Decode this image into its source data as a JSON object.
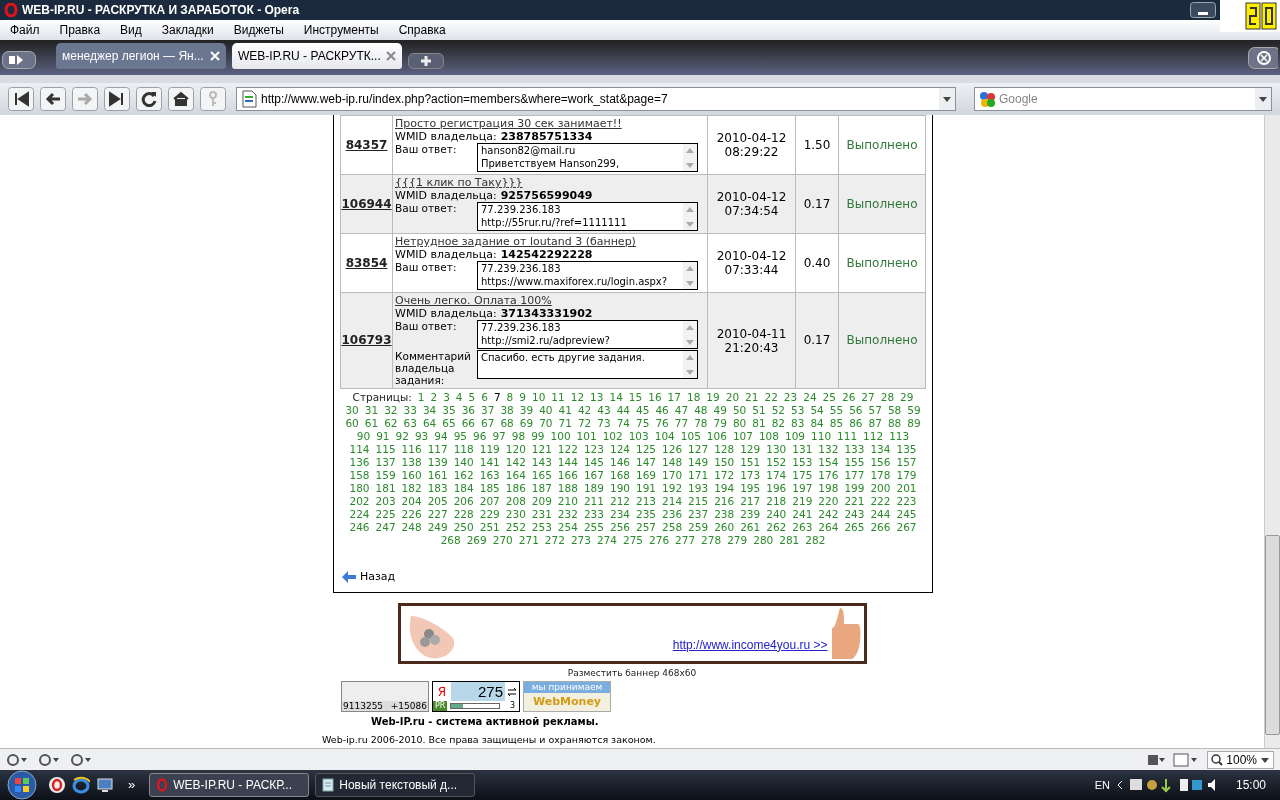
{
  "window": {
    "title": "WEB-IP.RU - РАСКРУТКА И ЗАРАБОТОК - Opera"
  },
  "menu": [
    "Файл",
    "Правка",
    "Вид",
    "Закладки",
    "Виджеты",
    "Инструменты",
    "Справка"
  ],
  "tabs": [
    {
      "label": "менеджер легион — Ян...",
      "selected": false
    },
    {
      "label": "WEB-IP.RU - РАСКРУТК...",
      "selected": true
    }
  ],
  "address": {
    "url": "http://www.web-ip.ru/index.php?action=members&where=work_stat&page=7"
  },
  "search": {
    "placeholder": "Google"
  },
  "tasks": [
    {
      "id": "84357",
      "title": "Просто регистрация 30 сек занимает!!",
      "wmid_label": "WMID владельца:",
      "wmid": "238785751334",
      "answer_label": "Ваш ответ:",
      "answer_lines": [
        "hanson82@mail.ru",
        "Приветствуем Hanson299,"
      ],
      "date": "2010-04-12",
      "time": "08:29:22",
      "amount": "1.50",
      "status": "Выполнено"
    },
    {
      "id": "106944",
      "title": "{{{1 клик по Таку}}}",
      "wmid_label": "WMID владельца:",
      "wmid": "925756599049",
      "answer_label": "Ваш ответ:",
      "answer_lines": [
        "77.239.236.183",
        "http://55rur.ru/?ref=1111111"
      ],
      "date": "2010-04-12",
      "time": "07:34:54",
      "amount": "0.17",
      "status": "Выполнено"
    },
    {
      "id": "83854",
      "title": "Нетрудное задание от loutand 3 (баннер)",
      "wmid_label": "WMID владельца:",
      "wmid": "142542292228",
      "answer_label": "Ваш ответ:",
      "answer_lines": [
        "77.239.236.183",
        "https://www.maxiforex.ru/login.aspx?"
      ],
      "date": "2010-04-12",
      "time": "07:33:44",
      "amount": "0.40",
      "status": "Выполнено"
    },
    {
      "id": "106793",
      "title": "Очень легко. Оплата 100%",
      "wmid_label": "WMID владельца:",
      "wmid": "371343331902",
      "answer_label": "Ваш ответ:",
      "answer_lines": [
        "77.239.236.183",
        "http://smi2.ru/adpreview?"
      ],
      "comment_label": "Комментарий владельца задания:",
      "comment_lines": [
        "Спасибо. есть другие задания."
      ],
      "date": "2010-04-11",
      "time": "21:20:43",
      "amount": "0.17",
      "status": "Выполнено"
    }
  ],
  "pagination": {
    "label": "Страницы:",
    "pages": [
      {
        "label": "1",
        "selected": false
      },
      {
        "label": "2",
        "selected": false
      },
      {
        "label": "3",
        "selected": false
      },
      {
        "label": "4",
        "selected": false
      },
      {
        "label": "5",
        "selected": false
      },
      {
        "label": "6",
        "selected": false
      },
      {
        "label": "7",
        "selected": true
      },
      {
        "label": "8",
        "selected": false
      },
      {
        "label": "9",
        "selected": false
      },
      {
        "label": "10",
        "selected": false
      },
      {
        "label": "11",
        "selected": false
      },
      {
        "label": "12",
        "selected": false
      },
      {
        "label": "13",
        "selected": false
      },
      {
        "label": "14",
        "selected": false
      },
      {
        "label": "15",
        "selected": false
      },
      {
        "label": "16",
        "selected": false
      },
      {
        "label": "17",
        "selected": false
      },
      {
        "label": "18",
        "selected": false
      },
      {
        "label": "19",
        "selected": false
      },
      {
        "label": "20",
        "selected": false
      },
      {
        "label": "21",
        "selected": false
      },
      {
        "label": "22",
        "selected": false
      },
      {
        "label": "23",
        "selected": false
      },
      {
        "label": "24",
        "selected": false
      },
      {
        "label": "25",
        "selected": false
      },
      {
        "label": "26",
        "selected": false
      },
      {
        "label": "27",
        "selected": false
      },
      {
        "label": "28",
        "selected": false
      },
      {
        "label": "29",
        "selected": false
      },
      {
        "label": "30",
        "selected": false
      },
      {
        "label": "31",
        "selected": false
      },
      {
        "label": "32",
        "selected": false
      },
      {
        "label": "33",
        "selected": false
      },
      {
        "label": "34",
        "selected": false
      },
      {
        "label": "35",
        "selected": false
      },
      {
        "label": "36",
        "selected": false
      },
      {
        "label": "37",
        "selected": false
      },
      {
        "label": "38",
        "selected": false
      },
      {
        "label": "39",
        "selected": false
      },
      {
        "label": "40",
        "selected": false
      },
      {
        "label": "41",
        "selected": false
      },
      {
        "label": "42",
        "selected": false
      },
      {
        "label": "43",
        "selected": false
      },
      {
        "label": "44",
        "selected": false
      },
      {
        "label": "45",
        "selected": false
      },
      {
        "label": "46",
        "selected": false
      },
      {
        "label": "47",
        "selected": false
      },
      {
        "label": "48",
        "selected": false
      },
      {
        "label": "49",
        "selected": false
      },
      {
        "label": "50",
        "selected": false
      },
      {
        "label": "51",
        "selected": false
      },
      {
        "label": "52",
        "selected": false
      },
      {
        "label": "53",
        "selected": false
      },
      {
        "label": "54",
        "selected": false
      },
      {
        "label": "55",
        "selected": false
      },
      {
        "label": "56",
        "selected": false
      },
      {
        "label": "57",
        "selected": false
      },
      {
        "label": "58",
        "selected": false
      },
      {
        "label": "59",
        "selected": false
      },
      {
        "label": "60",
        "selected": false
      },
      {
        "label": "61",
        "selected": false
      },
      {
        "label": "62",
        "selected": false
      },
      {
        "label": "63",
        "selected": false
      },
      {
        "label": "64",
        "selected": false
      },
      {
        "label": "65",
        "selected": false
      },
      {
        "label": "66",
        "selected": false
      },
      {
        "label": "67",
        "selected": false
      },
      {
        "label": "68",
        "selected": false
      },
      {
        "label": "69",
        "selected": false
      },
      {
        "label": "70",
        "selected": false
      },
      {
        "label": "71",
        "selected": false
      },
      {
        "label": "72",
        "selected": false
      },
      {
        "label": "73",
        "selected": false
      },
      {
        "label": "74",
        "selected": false
      },
      {
        "label": "75",
        "selected": false
      },
      {
        "label": "76",
        "selected": false
      },
      {
        "label": "77",
        "selected": false
      },
      {
        "label": "78",
        "selected": false
      },
      {
        "label": "79",
        "selected": false
      },
      {
        "label": "80",
        "selected": false
      },
      {
        "label": "81",
        "selected": false
      },
      {
        "label": "82",
        "selected": false
      },
      {
        "label": "83",
        "selected": false
      },
      {
        "label": "84",
        "selected": false
      },
      {
        "label": "85",
        "selected": false
      },
      {
        "label": "86",
        "selected": false
      },
      {
        "label": "87",
        "selected": false
      },
      {
        "label": "88",
        "selected": false
      },
      {
        "label": "89",
        "selected": false
      },
      {
        "label": "90",
        "selected": false
      },
      {
        "label": "91",
        "selected": false
      },
      {
        "label": "92",
        "selected": false
      },
      {
        "label": "93",
        "selected": false
      },
      {
        "label": "94",
        "selected": false
      },
      {
        "label": "95",
        "selected": false
      },
      {
        "label": "96",
        "selected": false
      },
      {
        "label": "97",
        "selected": false
      },
      {
        "label": "98",
        "selected": false
      },
      {
        "label": "99",
        "selected": false
      },
      {
        "label": "100",
        "selected": false
      },
      {
        "label": "101",
        "selected": false
      },
      {
        "label": "102",
        "selected": false
      },
      {
        "label": "103",
        "selected": false
      },
      {
        "label": "104",
        "selected": false
      },
      {
        "label": "105",
        "selected": false
      },
      {
        "label": "106",
        "selected": false
      },
      {
        "label": "107",
        "selected": false
      },
      {
        "label": "108",
        "selected": false
      },
      {
        "label": "109",
        "selected": false
      },
      {
        "label": "110",
        "selected": false
      },
      {
        "label": "111",
        "selected": false
      },
      {
        "label": "112",
        "selected": false
      },
      {
        "label": "113",
        "selected": false
      },
      {
        "label": "114",
        "selected": false
      },
      {
        "label": "115",
        "selected": false
      },
      {
        "label": "116",
        "selected": false
      },
      {
        "label": "117",
        "selected": false
      },
      {
        "label": "118",
        "selected": false
      },
      {
        "label": "119",
        "selected": false
      },
      {
        "label": "120",
        "selected": false
      },
      {
        "label": "121",
        "selected": false
      },
      {
        "label": "122",
        "selected": false
      },
      {
        "label": "123",
        "selected": false
      },
      {
        "label": "124",
        "selected": false
      },
      {
        "label": "125",
        "selected": false
      },
      {
        "label": "126",
        "selected": false
      },
      {
        "label": "127",
        "selected": false
      },
      {
        "label": "128",
        "selected": false
      },
      {
        "label": "129",
        "selected": false
      },
      {
        "label": "130",
        "selected": false
      },
      {
        "label": "131",
        "selected": false
      },
      {
        "label": "132",
        "selected": false
      },
      {
        "label": "133",
        "selected": false
      },
      {
        "label": "134",
        "selected": false
      },
      {
        "label": "135",
        "selected": false
      },
      {
        "label": "136",
        "selected": false
      },
      {
        "label": "137",
        "selected": false
      },
      {
        "label": "138",
        "selected": false
      },
      {
        "label": "139",
        "selected": false
      },
      {
        "label": "140",
        "selected": false
      },
      {
        "label": "141",
        "selected": false
      },
      {
        "label": "142",
        "selected": false
      },
      {
        "label": "143",
        "selected": false
      },
      {
        "label": "144",
        "selected": false
      },
      {
        "label": "145",
        "selected": false
      },
      {
        "label": "146",
        "selected": false
      },
      {
        "label": "147",
        "selected": false
      },
      {
        "label": "148",
        "selected": false
      },
      {
        "label": "149",
        "selected": false
      },
      {
        "label": "150",
        "selected": false
      },
      {
        "label": "151",
        "selected": false
      },
      {
        "label": "152",
        "selected": false
      },
      {
        "label": "153",
        "selected": false
      },
      {
        "label": "154",
        "selected": false
      },
      {
        "label": "155",
        "selected": false
      },
      {
        "label": "156",
        "selected": false
      },
      {
        "label": "157",
        "selected": false
      },
      {
        "label": "158",
        "selected": false
      },
      {
        "label": "159",
        "selected": false
      },
      {
        "label": "160",
        "selected": false
      },
      {
        "label": "161",
        "selected": false
      },
      {
        "label": "162",
        "selected": false
      },
      {
        "label": "163",
        "selected": false
      },
      {
        "label": "164",
        "selected": false
      },
      {
        "label": "165",
        "selected": false
      },
      {
        "label": "166",
        "selected": false
      },
      {
        "label": "167",
        "selected": false
      },
      {
        "label": "168",
        "selected": false
      },
      {
        "label": "169",
        "selected": false
      },
      {
        "label": "170",
        "selected": false
      },
      {
        "label": "171",
        "selected": false
      },
      {
        "label": "172",
        "selected": false
      },
      {
        "label": "173",
        "selected": false
      },
      {
        "label": "174",
        "selected": false
      },
      {
        "label": "175",
        "selected": false
      },
      {
        "label": "176",
        "selected": false
      },
      {
        "label": "177",
        "selected": false
      },
      {
        "label": "178",
        "selected": false
      },
      {
        "label": "179",
        "selected": false
      },
      {
        "label": "180",
        "selected": false
      },
      {
        "label": "181",
        "selected": false
      },
      {
        "label": "182",
        "selected": false
      },
      {
        "label": "183",
        "selected": false
      },
      {
        "label": "184",
        "selected": false
      },
      {
        "label": "185",
        "selected": false
      },
      {
        "label": "186",
        "selected": false
      },
      {
        "label": "187",
        "selected": false
      },
      {
        "label": "188",
        "selected": false
      },
      {
        "label": "189",
        "selected": false
      },
      {
        "label": "190",
        "selected": false
      },
      {
        "label": "191",
        "selected": false
      },
      {
        "label": "192",
        "selected": false
      },
      {
        "label": "193",
        "selected": false
      },
      {
        "label": "194",
        "selected": false
      },
      {
        "label": "195",
        "selected": false
      },
      {
        "label": "196",
        "selected": false
      },
      {
        "label": "197",
        "selected": false
      },
      {
        "label": "198",
        "selected": false
      },
      {
        "label": "199",
        "selected": false
      },
      {
        "label": "200",
        "selected": false
      },
      {
        "label": "201",
        "selected": false
      },
      {
        "label": "202",
        "selected": false
      },
      {
        "label": "203",
        "selected": false
      },
      {
        "label": "204",
        "selected": false
      },
      {
        "label": "205",
        "selected": false
      },
      {
        "label": "206",
        "selected": false
      },
      {
        "label": "207",
        "selected": false
      },
      {
        "label": "208",
        "selected": false
      },
      {
        "label": "209",
        "selected": false
      },
      {
        "label": "210",
        "selected": false
      },
      {
        "label": "211",
        "selected": false
      },
      {
        "label": "212",
        "selected": false
      },
      {
        "label": "213",
        "selected": false
      },
      {
        "label": "214",
        "selected": false
      },
      {
        "label": "215",
        "selected": false
      },
      {
        "label": "216",
        "selected": false
      },
      {
        "label": "217",
        "selected": false
      },
      {
        "label": "218",
        "selected": false
      },
      {
        "label": "219",
        "selected": false
      },
      {
        "label": "220",
        "selected": false
      },
      {
        "label": "221",
        "selected": false
      },
      {
        "label": "222",
        "selected": false
      },
      {
        "label": "223",
        "selected": false
      },
      {
        "label": "224",
        "selected": false
      },
      {
        "label": "225",
        "selected": false
      },
      {
        "label": "226",
        "selected": false
      },
      {
        "label": "227",
        "selected": false
      },
      {
        "label": "228",
        "selected": false
      },
      {
        "label": "229",
        "selected": false
      },
      {
        "label": "230",
        "selected": false
      },
      {
        "label": "231",
        "selected": false
      },
      {
        "label": "232",
        "selected": false
      },
      {
        "label": "233",
        "selected": false
      },
      {
        "label": "234",
        "selected": false
      },
      {
        "label": "235",
        "selected": false
      },
      {
        "label": "236",
        "selected": false
      },
      {
        "label": "237",
        "selected": false
      },
      {
        "label": "238",
        "selected": false
      },
      {
        "label": "239",
        "selected": false
      },
      {
        "label": "240",
        "selected": false
      },
      {
        "label": "241",
        "selected": false
      },
      {
        "label": "242",
        "selected": false
      },
      {
        "label": "243",
        "selected": false
      },
      {
        "label": "244",
        "selected": false
      },
      {
        "label": "245",
        "selected": false
      },
      {
        "label": "246",
        "selected": false
      },
      {
        "label": "247",
        "selected": false
      },
      {
        "label": "248",
        "selected": false
      },
      {
        "label": "249",
        "selected": false
      },
      {
        "label": "250",
        "selected": false
      },
      {
        "label": "251",
        "selected": false
      },
      {
        "label": "252",
        "selected": false
      },
      {
        "label": "253",
        "selected": false
      },
      {
        "label": "254",
        "selected": false
      },
      {
        "label": "255",
        "selected": false
      },
      {
        "label": "256",
        "selected": false
      },
      {
        "label": "257",
        "selected": false
      },
      {
        "label": "258",
        "selected": false
      },
      {
        "label": "259",
        "selected": false
      },
      {
        "label": "260",
        "selected": false
      },
      {
        "label": "261",
        "selected": false
      },
      {
        "label": "262",
        "selected": false
      },
      {
        "label": "263",
        "selected": false
      },
      {
        "label": "264",
        "selected": false
      },
      {
        "label": "265",
        "selected": false
      },
      {
        "label": "266",
        "selected": false
      },
      {
        "label": "267",
        "selected": false
      },
      {
        "label": "268",
        "selected": false
      },
      {
        "label": "269",
        "selected": false
      },
      {
        "label": "270",
        "selected": false
      },
      {
        "label": "271",
        "selected": false
      },
      {
        "label": "272",
        "selected": false
      },
      {
        "label": "273",
        "selected": false
      },
      {
        "label": "274",
        "selected": false
      },
      {
        "label": "275",
        "selected": false
      },
      {
        "label": "276",
        "selected": false
      },
      {
        "label": "277",
        "selected": false
      },
      {
        "label": "278",
        "selected": false
      },
      {
        "label": "279",
        "selected": false
      },
      {
        "label": "280",
        "selected": false
      },
      {
        "label": "281",
        "selected": false
      },
      {
        "label": "282",
        "selected": false
      }
    ]
  },
  "back_link": "Назад",
  "banner": {
    "link": "http://www.income4you.ru >>",
    "caption": "Разместить баннер 468x60"
  },
  "counters": {
    "hotlog_total": "9113255",
    "hotlog_delta": "+15086",
    "yandex_letter": "Я",
    "yandex_count": "275",
    "yandex_pr_label": "PR",
    "yandex_pr": "3",
    "webmoney_top": "мы принимаем",
    "webmoney_brand": "WebMoney"
  },
  "footer": {
    "tagline": "Web-IP.ru - система активной рекламы.",
    "copyright": "Web-ip.ru 2006-2010. Все права защищены и охраняются законом."
  },
  "status_bar": {
    "zoom": "100%"
  },
  "taskbar": {
    "buttons": [
      {
        "label": "WEB-IP.RU - РАСКР...",
        "selected": true
      },
      {
        "label": "Новый текстовый д...",
        "selected": false
      }
    ],
    "chevron": "»",
    "lang": "EN",
    "clock": "15:00"
  }
}
